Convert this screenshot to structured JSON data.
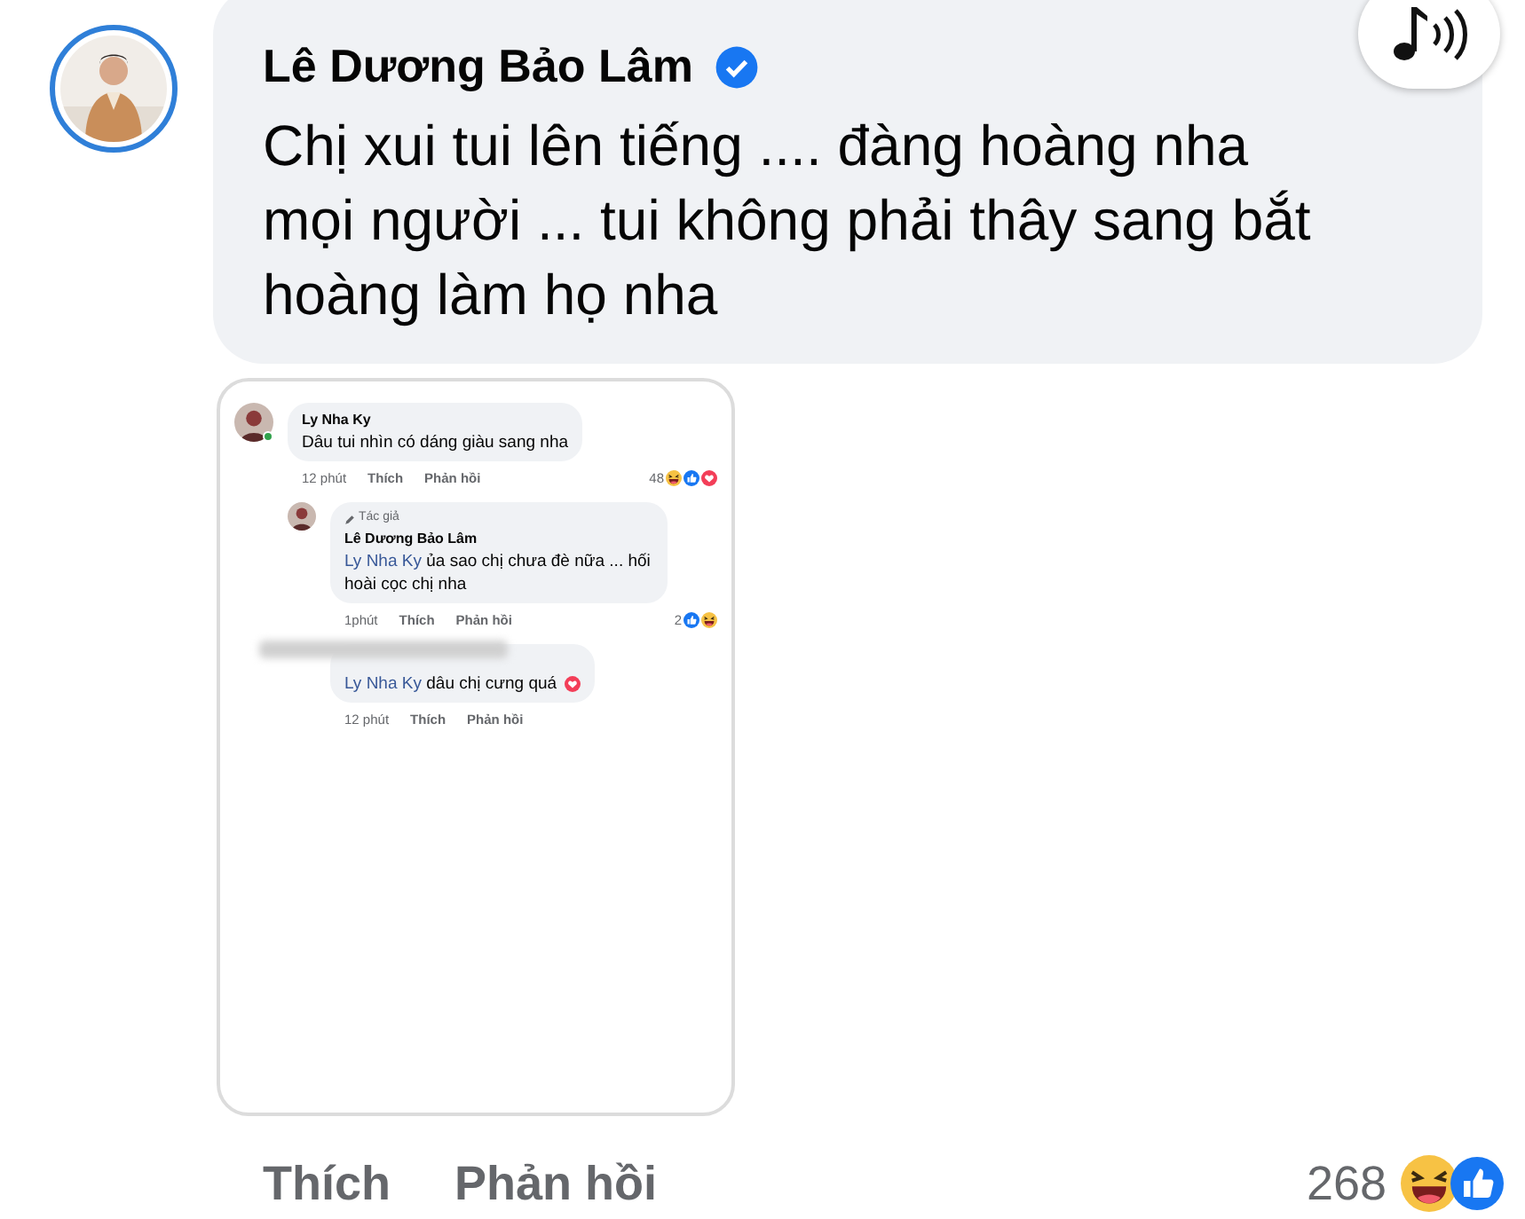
{
  "post": {
    "author": "Lê Dương Bảo Lâm",
    "verified": true,
    "text": "Chị xui tui lên tiếng .... đàng hoàng nha mọi người ... tui không phải thây sang bắt hoàng làm họ nha"
  },
  "embedded_screenshot": {
    "comments": [
      {
        "kind": "comment",
        "name": "Ly Nha Ky",
        "online": true,
        "text": "Dâu tui nhìn có dáng giàu sang nha",
        "time": "12 phút",
        "like": "Thích",
        "reply": "Phản hồi",
        "count": "48"
      },
      {
        "kind": "reply",
        "badge": "Tác giả",
        "name": "Lê Dương Bảo Lâm",
        "mention": "Ly Nha Ky",
        "text": "ủa sao chị chưa đè nữa ... hối hoài cọc chị nha",
        "time": "1phút",
        "like": "Thích",
        "reply": "Phản hồi",
        "count": "2"
      },
      {
        "kind": "reply",
        "mention": "Ly Nha Ky",
        "text": "dâu chị cưng quá",
        "time": "12 phút",
        "like": "Thích",
        "reply": "Phản hồi"
      }
    ]
  },
  "actions": {
    "like": "Thích",
    "reply": "Phản hồi",
    "count": "268"
  }
}
